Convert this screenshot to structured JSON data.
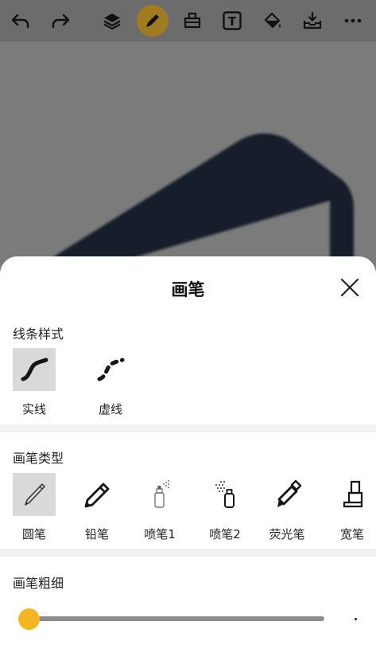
{
  "toolbar": {
    "items": [
      {
        "icon": "undo-icon"
      },
      {
        "icon": "redo-icon"
      },
      {
        "icon": "layers-icon"
      },
      {
        "icon": "pen-icon",
        "active": true
      },
      {
        "icon": "eraser-icon"
      },
      {
        "icon": "text-icon",
        "glyph": "T"
      },
      {
        "icon": "fill-bucket-icon"
      },
      {
        "icon": "save-tray-icon"
      },
      {
        "icon": "more-icon"
      }
    ],
    "active_color": "#a07b20"
  },
  "panel": {
    "title": "画笔",
    "line_style": {
      "label": "线条样式",
      "options": [
        {
          "label": "实线",
          "icon": "solid-line-icon",
          "selected": true
        },
        {
          "label": "虚线",
          "icon": "dashed-line-icon",
          "selected": false
        }
      ]
    },
    "brush_type": {
      "label": "画笔类型",
      "options": [
        {
          "label": "圆笔",
          "icon": "round-pen-icon",
          "selected": true
        },
        {
          "label": "铅笔",
          "icon": "pencil-icon",
          "selected": false
        },
        {
          "label": "喷笔1",
          "icon": "spray-can-icon",
          "selected": false
        },
        {
          "label": "喷笔2",
          "icon": "spray-bottle-icon",
          "selected": false
        },
        {
          "label": "荧光笔",
          "icon": "highlighter-icon",
          "selected": false
        },
        {
          "label": "宽笔",
          "icon": "wide-marker-icon",
          "selected": false
        }
      ]
    },
    "brush_size": {
      "label": "画笔粗细",
      "value": 0.0,
      "thumb_color": "#f5b520"
    }
  }
}
